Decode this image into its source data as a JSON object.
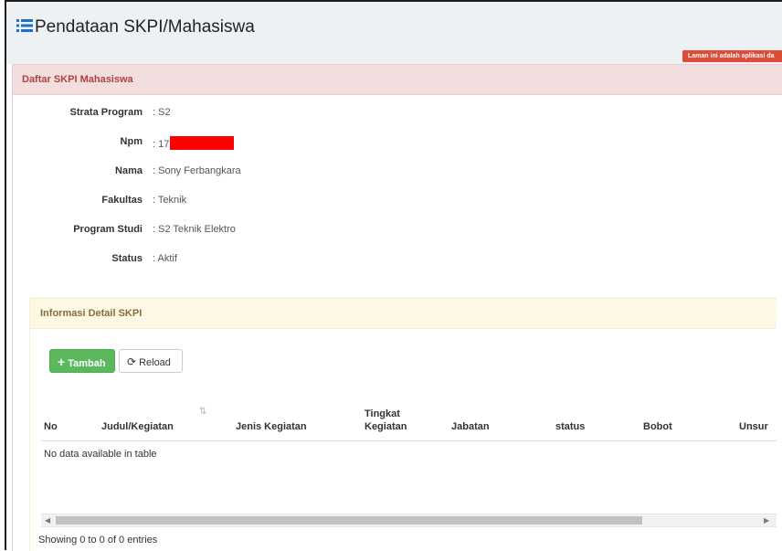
{
  "header": {
    "title": "Pendataan SKPI/Mahasiswa",
    "title_icon": "list-icon",
    "notice": "Laman ini adalah aplikasi da"
  },
  "panel": {
    "heading": "Daftar SKPI Mahasiswa",
    "info": [
      {
        "label": "Strata Program",
        "value": ": S2"
      },
      {
        "label": "Npm",
        "value": ": 17"
      },
      {
        "label": "Nama",
        "value": ": Sony Ferbangkara"
      },
      {
        "label": "Fakultas",
        "value": ": Teknik"
      },
      {
        "label": "Program Studi",
        "value": ": S2 Teknik Elektro"
      },
      {
        "label": "Status",
        "value": ": Aktif"
      }
    ]
  },
  "detail": {
    "heading": "Informasi Detail SKPI",
    "add_label": "Tambah",
    "reload_label": "Reload",
    "columns": [
      "No",
      "Judul/Kegiatan",
      "Jenis Kegiatan",
      "Tingkat Kegiatan",
      "Jabatan",
      "status",
      "Bobot",
      "Unsur"
    ],
    "empty_message": "No data available in table",
    "info_text": "Showing 0 to 0 of 0 entries"
  },
  "colors": {
    "danger_heading_bg": "#f2dede",
    "warning_heading_bg": "#fcf8e3",
    "success_button": "#5cb85c",
    "notice_bg": "#dd4b39",
    "redaction": "#ff0000"
  }
}
